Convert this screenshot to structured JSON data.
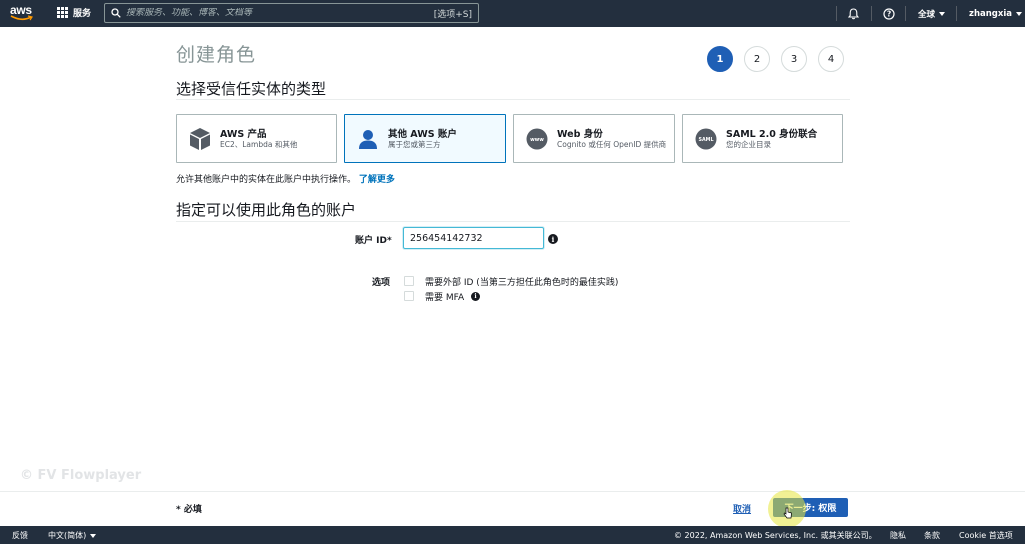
{
  "topnav": {
    "logo_text": "aws",
    "services_label": "服务",
    "search_placeholder": "搜索服务、功能、博客、文档等",
    "search_shortcut": "[选项+S]",
    "region_label": "全球",
    "user_label": "zhangxia"
  },
  "page": {
    "title": "创建角色",
    "steps": [
      "1",
      "2",
      "3",
      "4"
    ],
    "active_step": 1,
    "section1_heading": "选择受信任实体的类型",
    "entity_types": [
      {
        "title": "AWS 产品",
        "subtitle": "EC2、Lambda 和其他",
        "icon": "cube-icon"
      },
      {
        "title": "其他 AWS 账户",
        "subtitle": "属于您或第三方",
        "icon": "user-icon"
      },
      {
        "title": "Web 身份",
        "subtitle": "Cognito 或任何 OpenID 提供商",
        "icon": "www-icon",
        "icon_text": "www"
      },
      {
        "title": "SAML 2.0 身份联合",
        "subtitle": "您的企业目录",
        "icon": "saml-icon",
        "icon_text": "SAML"
      }
    ],
    "selected_entity": 1,
    "description": "允许其他账户中的实体在此账户中执行操作。",
    "learn_more": "了解更多",
    "section2_heading": "指定可以使用此角色的账户",
    "account_id_label": "账户 ID*",
    "account_id_value": "256454142732",
    "options_label": "选项",
    "options": [
      {
        "label": "需要外部 ID (当第三方担任此角色时的最佳实践)",
        "checked": false
      },
      {
        "label": "需要 MFA",
        "checked": false
      }
    ]
  },
  "watermark": "© FV Flowplayer",
  "footer": {
    "required_note": "* 必填",
    "cancel_label": "取消",
    "next_label": "下一步: 权限"
  },
  "bottombar": {
    "feedback": "反馈",
    "language": "中文(简体)",
    "copyright": "© 2022, Amazon Web Services, Inc. 或其关联公司。",
    "privacy": "隐私",
    "terms": "条款",
    "cookie": "Cookie 首选项"
  },
  "colors": {
    "nav_bg": "#232f3e",
    "primary": "#1f5fb5",
    "link": "#0073bb",
    "selected_card_bg": "#f1faff"
  }
}
